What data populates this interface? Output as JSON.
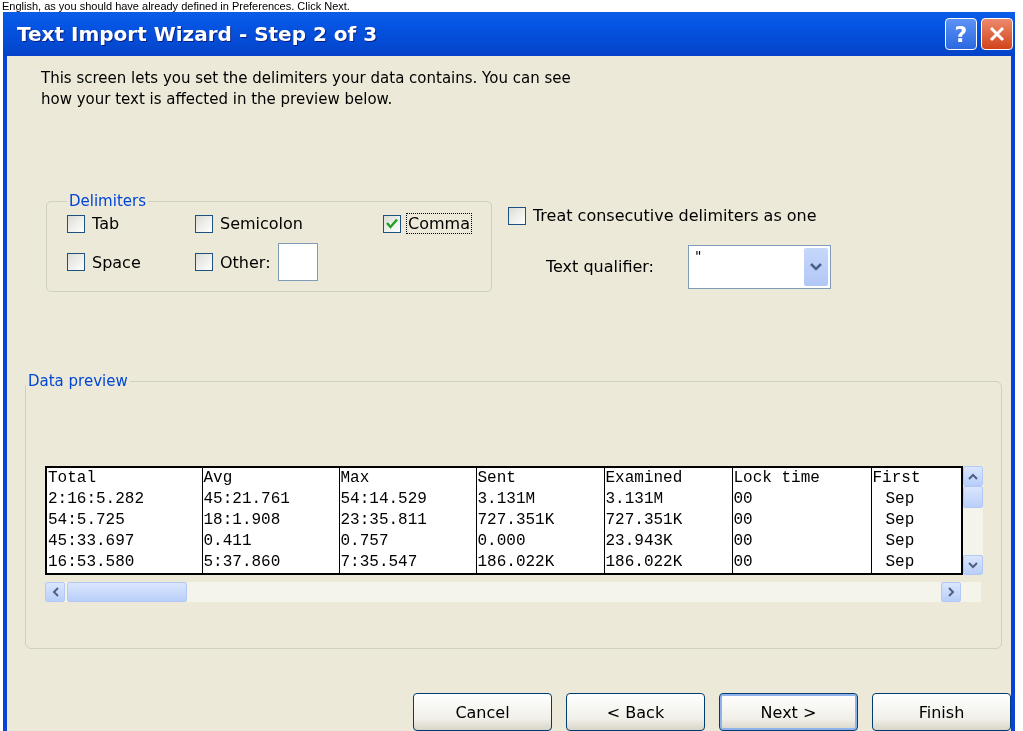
{
  "page_text": "English, as you should have already defined in Preferences. Click Next.",
  "window": {
    "title": "Text Import Wizard - Step 2 of 3",
    "help_glyph": "?"
  },
  "intro": "This screen lets you set the delimiters your data contains.  You can see\nhow your text is affected in the preview below.",
  "delimiters": {
    "label": "Delimiters",
    "options": [
      {
        "label": "Tab",
        "checked": false,
        "kind": "plain"
      },
      {
        "label": "Semicolon",
        "checked": false,
        "kind": "plain"
      },
      {
        "label": "Comma",
        "checked": true,
        "kind": "plain"
      },
      {
        "label": "Space",
        "checked": false,
        "kind": "plain"
      },
      {
        "label": "Other:",
        "checked": false,
        "kind": "field"
      }
    ]
  },
  "treat_consecutive": {
    "label": "Treat consecutive delimiters as one",
    "checked": false
  },
  "text_qualifier": {
    "label": "Text qualifier:",
    "value": "\""
  },
  "preview": {
    "label": "Data preview",
    "columns": [
      "Total",
      "Avg",
      "Max",
      "Sent",
      "Examined",
      "Lock time",
      "First"
    ],
    "rows": [
      [
        "2:16:5.282",
        "45:21.761",
        "54:14.529",
        "3.131M",
        "3.131M",
        "00",
        "Sep"
      ],
      [
        "54:5.725",
        "18:1.908",
        "23:35.811",
        "727.351K",
        "727.351K",
        "00",
        "Sep"
      ],
      [
        "45:33.697",
        "0.411",
        "0.757",
        "0.000",
        "23.943K",
        "00",
        "Sep"
      ],
      [
        "16:53.580",
        "5:37.860",
        "7:35.547",
        "186.022K",
        "186.022K",
        "00",
        "Sep"
      ]
    ]
  },
  "buttons": [
    {
      "label": "Cancel",
      "default": false
    },
    {
      "label": "< Back",
      "default": false
    },
    {
      "label": "Next >",
      "default": true
    },
    {
      "label": "Finish",
      "default": false
    }
  ]
}
